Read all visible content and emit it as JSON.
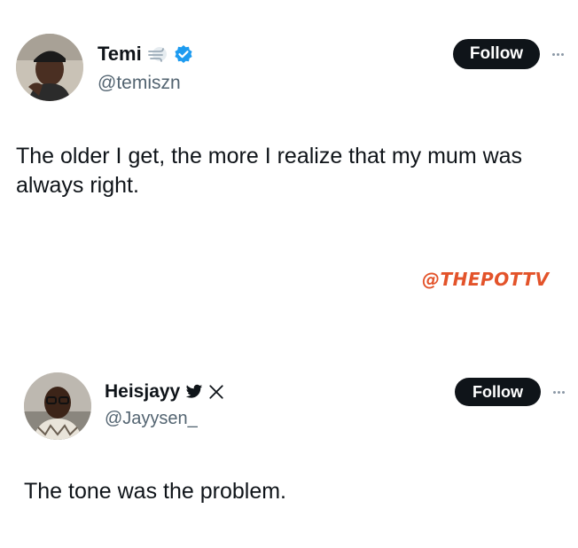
{
  "tweet1": {
    "display_name": "Temi",
    "handle": "@temiszn",
    "follow_label": "Follow",
    "text": "The older I get, the more I realize that my mum was always right.",
    "icons": [
      "wind-emoji-icon",
      "verified-badge-icon"
    ],
    "verified_color": "#1d9bf0"
  },
  "watermark": {
    "text": "@THEPOTTV",
    "color": "#e3532a"
  },
  "tweet2": {
    "display_name": "Heisjayy",
    "handle": "@Jayysen_",
    "follow_label": "Follow",
    "text": "The tone was the problem.",
    "icons": [
      "twitter-bird-icon",
      "x-logo-icon"
    ]
  }
}
